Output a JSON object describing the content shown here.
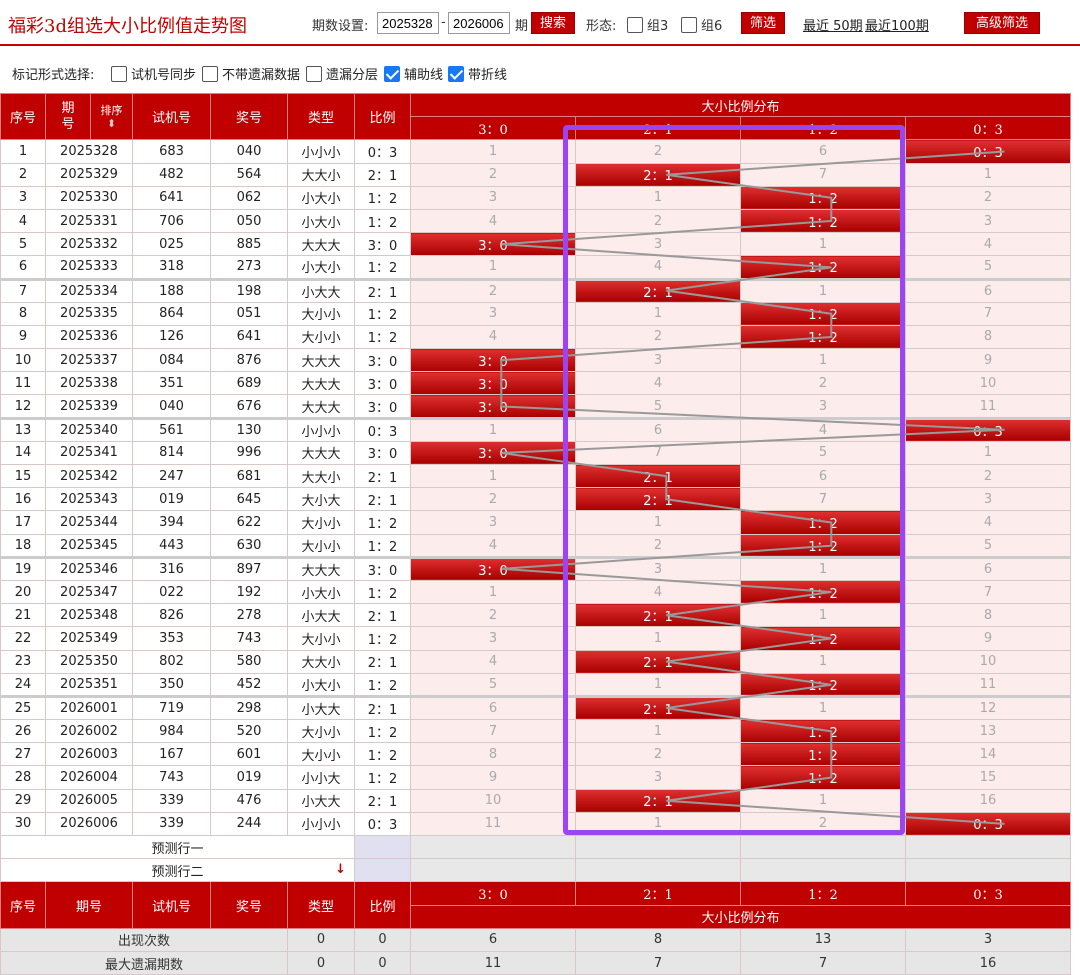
{
  "header": {
    "title": "福彩3d组选大小比例值走势图",
    "period_label": "期数设置:",
    "from_value": "2025328",
    "dash": "-",
    "to_value": "2026006",
    "period_suffix": "期",
    "search_label": "搜索",
    "shape_label": "形态:",
    "group3_label": "组3",
    "group6_label": "组6",
    "filter_label": "筛选",
    "recent50_label": "最近 50期",
    "recent100_label": "最近100期",
    "advanced_label": "高级筛选"
  },
  "mark": {
    "label": "标记形式选择:",
    "opt1": "试机号同步",
    "opt2": "不带遗漏数据",
    "opt3": "遗漏分层",
    "opt4": "辅助线",
    "opt5": "带折线",
    "opt4_checked": true,
    "opt5_checked": true
  },
  "table": {
    "col_seq": "序号",
    "col_period_a": "期",
    "col_period_b": "号",
    "col_sort": "排序",
    "col_test": "试机号",
    "col_prize": "奖号",
    "col_type": "类型",
    "col_ratio": "比例",
    "col_dist": "大小比例分布",
    "col_period_full": "期号",
    "ratios": [
      "3：0",
      "2：1",
      "1：2",
      "0：3"
    ],
    "rows": [
      {
        "seq": "1",
        "period": "2025328",
        "test": "683",
        "prize": "040",
        "type": "小小小",
        "ratio": "0：3",
        "hit": 3,
        "miss": [
          "1",
          "2",
          "6",
          "0：3"
        ]
      },
      {
        "seq": "2",
        "period": "2025329",
        "test": "482",
        "prize": "564",
        "type": "大大小",
        "ratio": "2：1",
        "hit": 1,
        "miss": [
          "2",
          "2：1",
          "7",
          "1"
        ]
      },
      {
        "seq": "3",
        "period": "2025330",
        "test": "641",
        "prize": "062",
        "type": "小大小",
        "ratio": "1：2",
        "hit": 2,
        "miss": [
          "3",
          "1",
          "1：2",
          "2"
        ]
      },
      {
        "seq": "4",
        "period": "2025331",
        "test": "706",
        "prize": "050",
        "type": "小大小",
        "ratio": "1：2",
        "hit": 2,
        "miss": [
          "4",
          "2",
          "1：2",
          "3"
        ]
      },
      {
        "seq": "5",
        "period": "2025332",
        "test": "025",
        "prize": "885",
        "type": "大大大",
        "ratio": "3：0",
        "hit": 0,
        "miss": [
          "3：0",
          "3",
          "1",
          "4"
        ]
      },
      {
        "seq": "6",
        "period": "2025333",
        "test": "318",
        "prize": "273",
        "type": "小大小",
        "ratio": "1：2",
        "hit": 2,
        "miss": [
          "1",
          "4",
          "1：2",
          "5"
        ]
      },
      {
        "seq": "7",
        "period": "2025334",
        "test": "188",
        "prize": "198",
        "type": "小大大",
        "ratio": "2：1",
        "hit": 1,
        "miss": [
          "2",
          "2：1",
          "1",
          "6"
        ]
      },
      {
        "seq": "8",
        "period": "2025335",
        "test": "864",
        "prize": "051",
        "type": "大小小",
        "ratio": "1：2",
        "hit": 2,
        "miss": [
          "3",
          "1",
          "1：2",
          "7"
        ]
      },
      {
        "seq": "9",
        "period": "2025336",
        "test": "126",
        "prize": "641",
        "type": "大小小",
        "ratio": "1：2",
        "hit": 2,
        "miss": [
          "4",
          "2",
          "1：2",
          "8"
        ]
      },
      {
        "seq": "10",
        "period": "2025337",
        "test": "084",
        "prize": "876",
        "type": "大大大",
        "ratio": "3：0",
        "hit": 0,
        "miss": [
          "3：0",
          "3",
          "1",
          "9"
        ]
      },
      {
        "seq": "11",
        "period": "2025338",
        "test": "351",
        "prize": "689",
        "type": "大大大",
        "ratio": "3：0",
        "hit": 0,
        "miss": [
          "3：0",
          "4",
          "2",
          "10"
        ]
      },
      {
        "seq": "12",
        "period": "2025339",
        "test": "040",
        "prize": "676",
        "type": "大大大",
        "ratio": "3：0",
        "hit": 0,
        "miss": [
          "3：0",
          "5",
          "3",
          "11"
        ]
      },
      {
        "seq": "13",
        "period": "2025340",
        "test": "561",
        "prize": "130",
        "type": "小小小",
        "ratio": "0：3",
        "hit": 3,
        "miss": [
          "1",
          "6",
          "4",
          "0：3"
        ]
      },
      {
        "seq": "14",
        "period": "2025341",
        "test": "814",
        "prize": "996",
        "type": "大大大",
        "ratio": "3：0",
        "hit": 0,
        "miss": [
          "3：0",
          "7",
          "5",
          "1"
        ]
      },
      {
        "seq": "15",
        "period": "2025342",
        "test": "247",
        "prize": "681",
        "type": "大大小",
        "ratio": "2：1",
        "hit": 1,
        "miss": [
          "1",
          "2：1",
          "6",
          "2"
        ]
      },
      {
        "seq": "16",
        "period": "2025343",
        "test": "019",
        "prize": "645",
        "type": "大小大",
        "ratio": "2：1",
        "hit": 1,
        "miss": [
          "2",
          "2：1",
          "7",
          "3"
        ]
      },
      {
        "seq": "17",
        "period": "2025344",
        "test": "394",
        "prize": "622",
        "type": "大小小",
        "ratio": "1：2",
        "hit": 2,
        "miss": [
          "3",
          "1",
          "1：2",
          "4"
        ]
      },
      {
        "seq": "18",
        "period": "2025345",
        "test": "443",
        "prize": "630",
        "type": "大小小",
        "ratio": "1：2",
        "hit": 2,
        "miss": [
          "4",
          "2",
          "1：2",
          "5"
        ]
      },
      {
        "seq": "19",
        "period": "2025346",
        "test": "316",
        "prize": "897",
        "type": "大大大",
        "ratio": "3：0",
        "hit": 0,
        "miss": [
          "3：0",
          "3",
          "1",
          "6"
        ]
      },
      {
        "seq": "20",
        "period": "2025347",
        "test": "022",
        "prize": "192",
        "type": "小大小",
        "ratio": "1：2",
        "hit": 2,
        "miss": [
          "1",
          "4",
          "1：2",
          "7"
        ]
      },
      {
        "seq": "21",
        "period": "2025348",
        "test": "826",
        "prize": "278",
        "type": "小大大",
        "ratio": "2：1",
        "hit": 1,
        "miss": [
          "2",
          "2：1",
          "1",
          "8"
        ]
      },
      {
        "seq": "22",
        "period": "2025349",
        "test": "353",
        "prize": "743",
        "type": "大小小",
        "ratio": "1：2",
        "hit": 2,
        "miss": [
          "3",
          "1",
          "1：2",
          "9"
        ]
      },
      {
        "seq": "23",
        "period": "2025350",
        "test": "802",
        "prize": "580",
        "type": "大大小",
        "ratio": "2：1",
        "hit": 1,
        "miss": [
          "4",
          "2：1",
          "1",
          "10"
        ]
      },
      {
        "seq": "24",
        "period": "2025351",
        "test": "350",
        "prize": "452",
        "type": "小大小",
        "ratio": "1：2",
        "hit": 2,
        "miss": [
          "5",
          "1",
          "1：2",
          "11"
        ]
      },
      {
        "seq": "25",
        "period": "2026001",
        "test": "719",
        "prize": "298",
        "type": "小大大",
        "ratio": "2：1",
        "hit": 1,
        "miss": [
          "6",
          "2：1",
          "1",
          "12"
        ]
      },
      {
        "seq": "26",
        "period": "2026002",
        "test": "984",
        "prize": "520",
        "type": "大小小",
        "ratio": "1：2",
        "hit": 2,
        "miss": [
          "7",
          "1",
          "1：2",
          "13"
        ]
      },
      {
        "seq": "27",
        "period": "2026003",
        "test": "167",
        "prize": "601",
        "type": "大小小",
        "ratio": "1：2",
        "hit": 2,
        "miss": [
          "8",
          "2",
          "1：2",
          "14"
        ]
      },
      {
        "seq": "28",
        "period": "2026004",
        "test": "743",
        "prize": "019",
        "type": "小小大",
        "ratio": "1：2",
        "hit": 2,
        "miss": [
          "9",
          "3",
          "1：2",
          "15"
        ]
      },
      {
        "seq": "29",
        "period": "2026005",
        "test": "339",
        "prize": "476",
        "type": "小大大",
        "ratio": "2：1",
        "hit": 1,
        "miss": [
          "10",
          "2：1",
          "1",
          "16"
        ]
      },
      {
        "seq": "30",
        "period": "2026006",
        "test": "339",
        "prize": "244",
        "type": "小小小",
        "ratio": "0：3",
        "hit": 3,
        "miss": [
          "11",
          "1",
          "2",
          "0：3"
        ]
      }
    ],
    "pred1": "预测行一",
    "pred2": "预测行二",
    "pred_arrow": "↓",
    "stats": [
      {
        "label": "出现次数",
        "type": "0",
        "ratio": "0",
        "vals": [
          "6",
          "8",
          "13",
          "3"
        ]
      },
      {
        "label": "最大遗漏期数",
        "type": "0",
        "ratio": "0",
        "vals": [
          "11",
          "7",
          "7",
          "16"
        ]
      }
    ]
  },
  "colors": {
    "brand": "#c00000",
    "highlight": "#9b44f0",
    "check": "#1877f2"
  }
}
